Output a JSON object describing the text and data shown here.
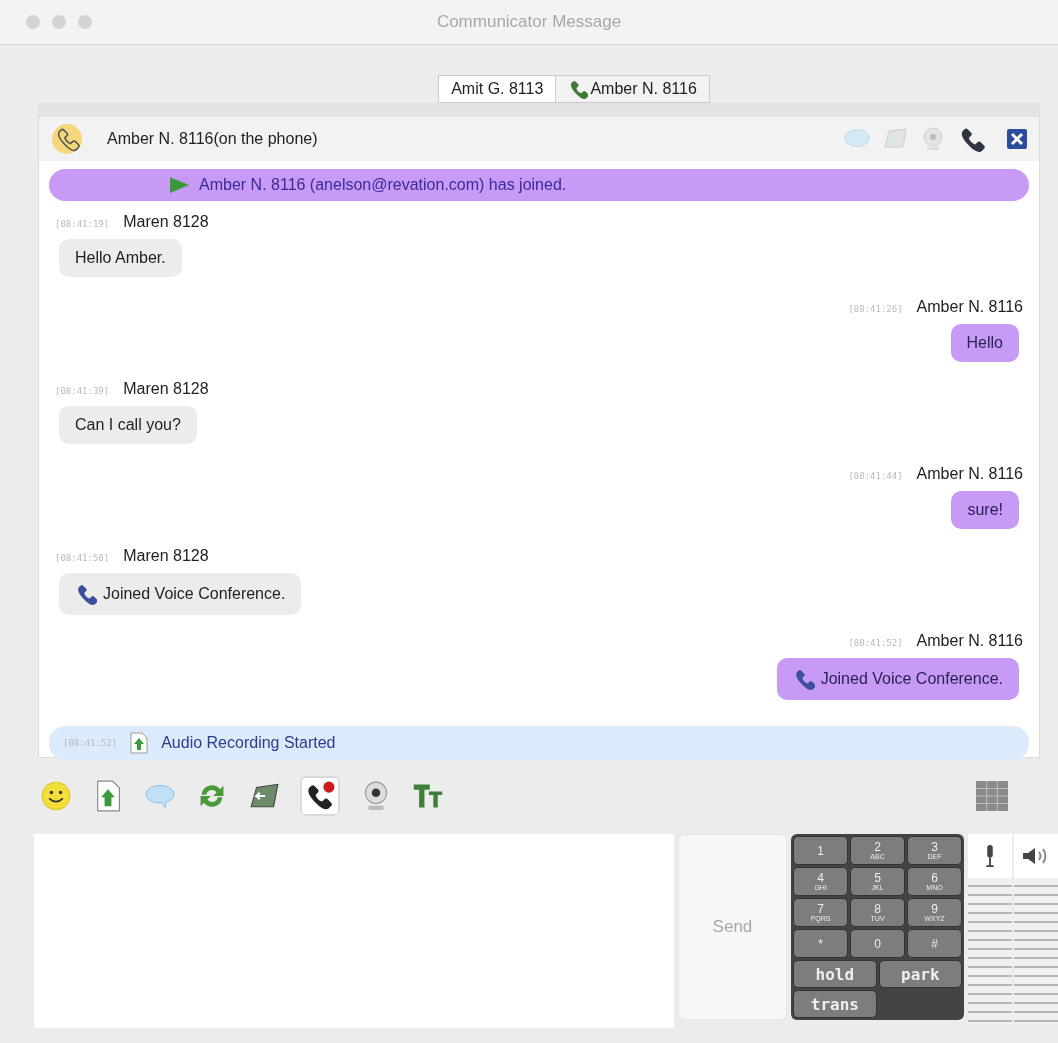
{
  "window": {
    "title": "Communicator Message"
  },
  "tabs": [
    {
      "label": "Amit G. 8113",
      "selected": false,
      "on_call": false
    },
    {
      "label": "Amber N. 8116",
      "selected": true,
      "on_call": true
    }
  ],
  "header": {
    "status": "Amber N. 8116(on the phone)"
  },
  "messages": [
    {
      "kind": "system",
      "text": "Amber N. 8116 (anelson@revation.com) has joined."
    },
    {
      "kind": "incoming",
      "time": "[08:41:19]",
      "sender": "Maren 8128",
      "text": "Hello Amber.",
      "voice": false
    },
    {
      "kind": "outgoing",
      "time": "[08:41:26]",
      "sender": "Amber N. 8116",
      "text": "Hello",
      "voice": false
    },
    {
      "kind": "incoming",
      "time": "[08:41:39]",
      "sender": "Maren 8128",
      "text": "Can I call you?",
      "voice": false
    },
    {
      "kind": "outgoing",
      "time": "[08:41:44]",
      "sender": "Amber N. 8116",
      "text": "sure!",
      "voice": false
    },
    {
      "kind": "incoming",
      "time": "[08:41:50]",
      "sender": "Maren 8128",
      "text": "Joined Voice Conference.",
      "voice": true
    },
    {
      "kind": "outgoing",
      "time": "[08:41:52]",
      "sender": "Amber N. 8116",
      "text": "Joined Voice Conference.",
      "voice": true
    },
    {
      "kind": "notice",
      "time": "[08:41:52]",
      "text": "Audio Recording Started"
    }
  ],
  "send_button": "Send",
  "keypad": [
    {
      "digit": "1"
    },
    {
      "digit": "2",
      "letters": "ABC"
    },
    {
      "digit": "3",
      "letters": "DEF"
    },
    {
      "digit": "4",
      "letters": "GHI"
    },
    {
      "digit": "5",
      "letters": "JKL"
    },
    {
      "digit": "6",
      "letters": "MNO"
    },
    {
      "digit": "7",
      "letters": "PQRS"
    },
    {
      "digit": "8",
      "letters": "TUV"
    },
    {
      "digit": "9",
      "letters": "WXYZ"
    },
    {
      "digit": "*"
    },
    {
      "digit": "0"
    },
    {
      "digit": "#"
    }
  ],
  "call_buttons": [
    "hold",
    "park",
    "trans"
  ]
}
